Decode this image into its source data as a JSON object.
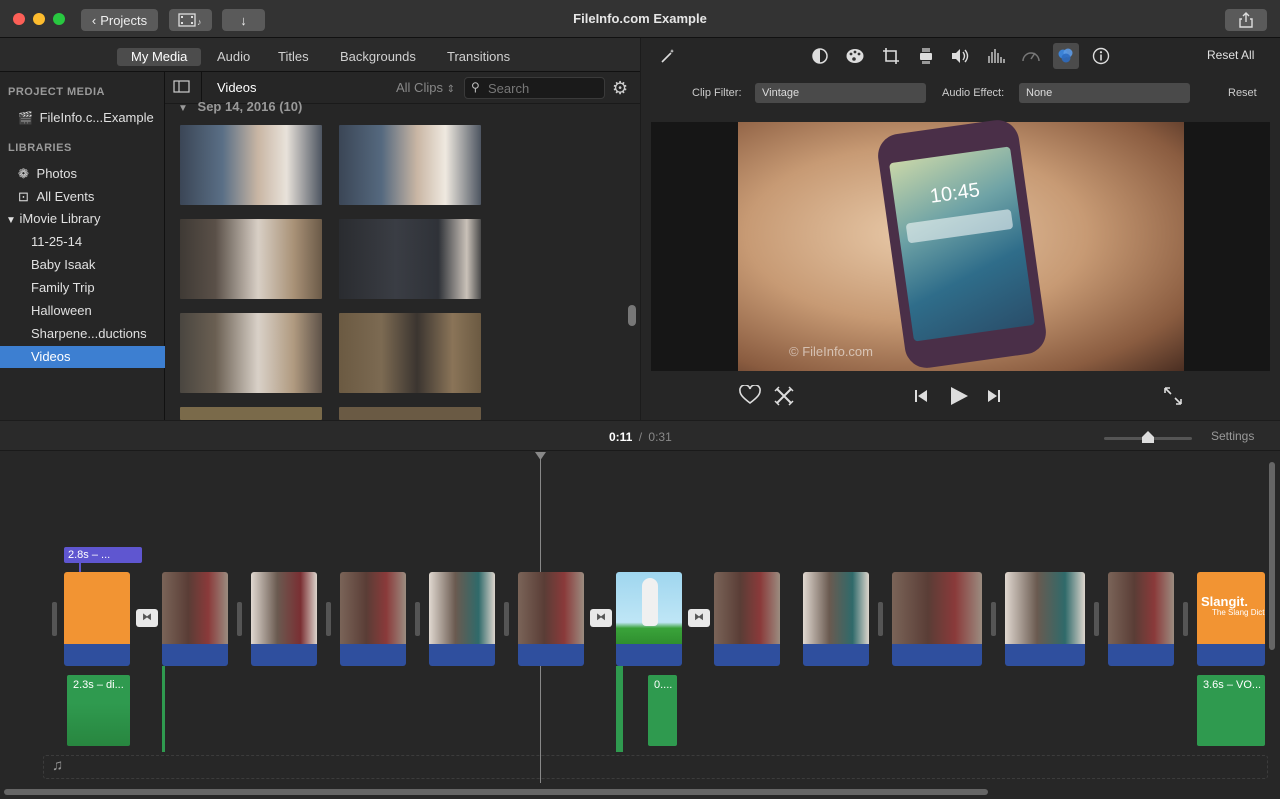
{
  "window": {
    "title": "FileInfo.com Example",
    "projects_button": "Projects"
  },
  "browser_tabs": [
    "My Media",
    "Audio",
    "Titles",
    "Backgrounds",
    "Transitions"
  ],
  "sidebar": {
    "project_media_header": "PROJECT MEDIA",
    "project_item": "FileInfo.c...Example",
    "libraries_header": "LIBRARIES",
    "photos": "Photos",
    "all_events": "All Events",
    "library": "iMovie Library",
    "events": [
      "11-25-14",
      "Baby Isaak",
      "Family Trip",
      "Halloween",
      "Sharpene...ductions",
      "Videos"
    ]
  },
  "media": {
    "title": "Videos",
    "filter": "All Clips",
    "search_placeholder": "Search",
    "group_label": "Sep 14, 2016  (10)"
  },
  "viewer": {
    "reset_all": "Reset All",
    "reset": "Reset",
    "clip_filter_label": "Clip Filter:",
    "clip_filter_value": "Vintage",
    "audio_effect_label": "Audio Effect:",
    "audio_effect_value": "None",
    "phone_time": "10:45",
    "watermark": "© FileInfo.com"
  },
  "timeline": {
    "current_time": "0:11",
    "separator": "/",
    "total_time": "0:31",
    "settings": "Settings",
    "title_clip_label": "2.8s – ...",
    "audio_clip_1": "2.3s – di...",
    "audio_clip_2": "0....",
    "audio_clip_3": "3.6s – VO...",
    "slangit_title": "Slangit.",
    "slangit_sub": "The Slang Dictio",
    "zoom_level": 0.5
  },
  "colors": {
    "selection": "#3d7fd1",
    "orange_clip": "#f29433",
    "audio_green": "#2f9a4f",
    "title_purple": "#5f56d0",
    "wave_blue": "#2f4f9e"
  }
}
